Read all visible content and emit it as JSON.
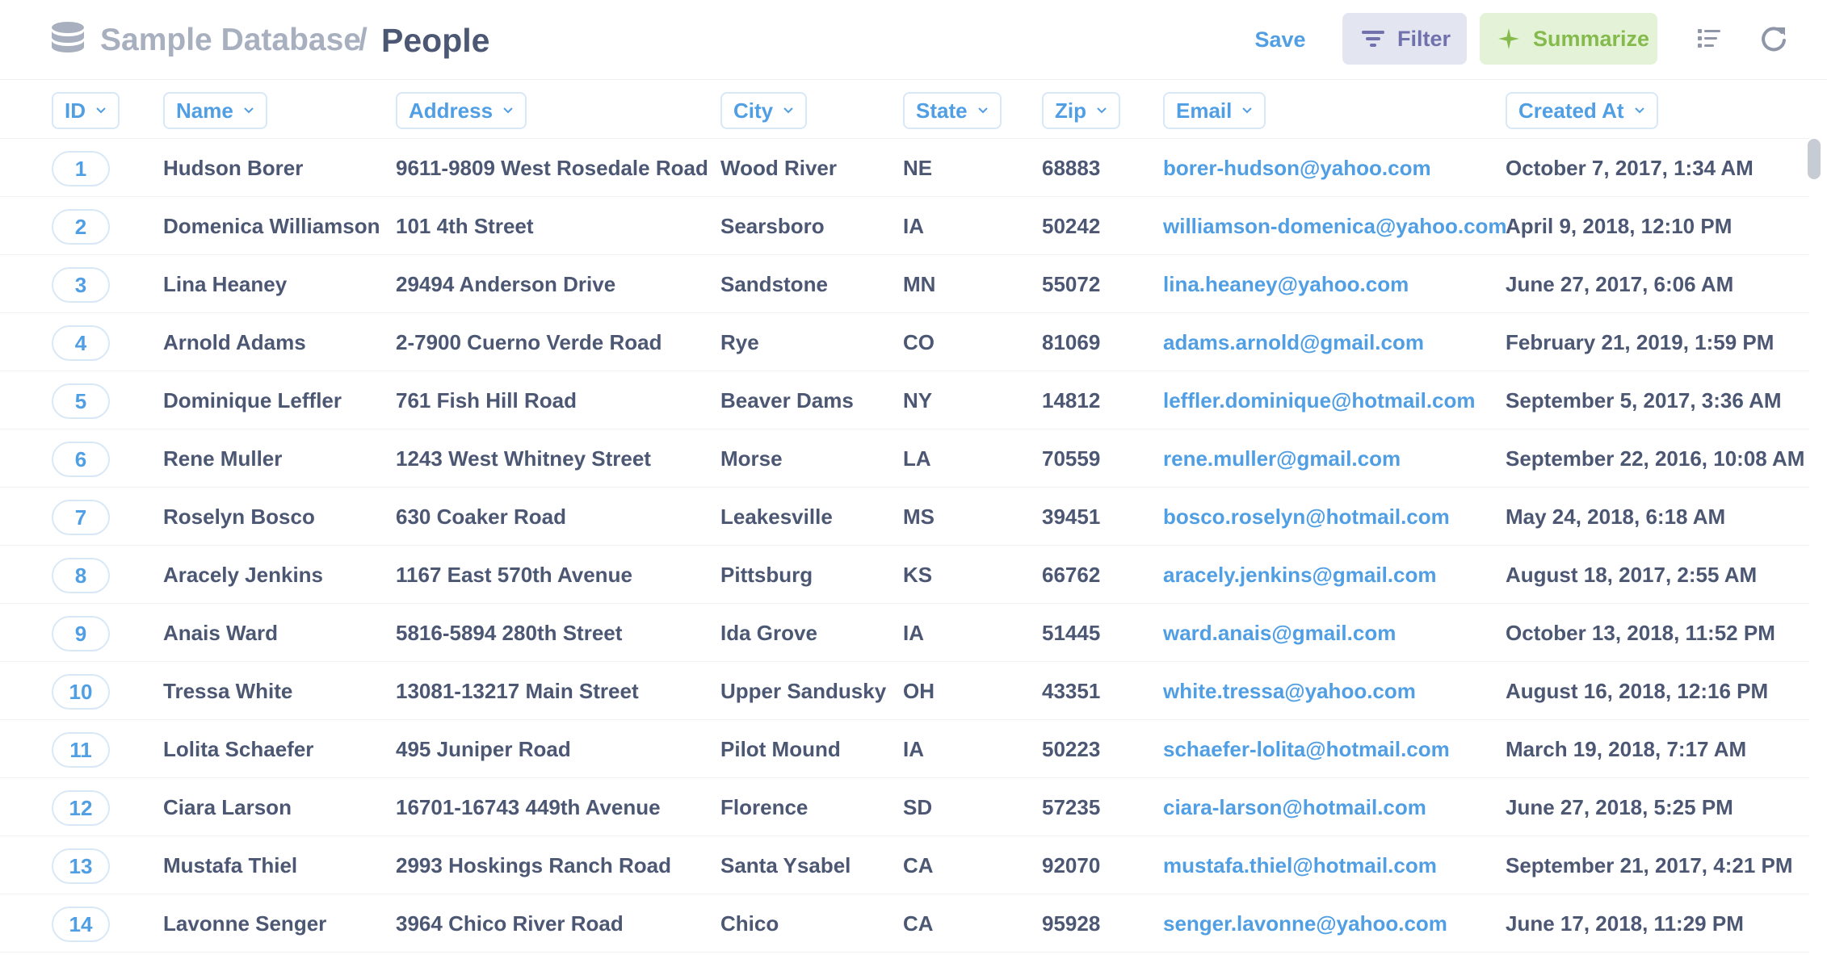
{
  "header": {
    "database": "Sample Database",
    "separator": "/",
    "table": "People",
    "save_label": "Save",
    "filter_label": "Filter",
    "summarize_label": "Summarize",
    "colors": {
      "accent": "#509ee3",
      "filter": "#7172ad",
      "summarize": "#84bb4c"
    }
  },
  "columns": [
    "ID",
    "Name",
    "Address",
    "City",
    "State",
    "Zip",
    "Email",
    "Created At"
  ],
  "rows": [
    [
      "1",
      "Hudson Borer",
      "9611-9809 West Rosedale Road",
      "Wood River",
      "NE",
      "68883",
      "borer-hudson@yahoo.com",
      "October 7, 2017, 1:34 AM"
    ],
    [
      "2",
      "Domenica Williamson",
      "101 4th Street",
      "Searsboro",
      "IA",
      "50242",
      "williamson-domenica@yahoo.com",
      "April 9, 2018, 12:10 PM"
    ],
    [
      "3",
      "Lina Heaney",
      "29494 Anderson Drive",
      "Sandstone",
      "MN",
      "55072",
      "lina.heaney@yahoo.com",
      "June 27, 2017, 6:06 AM"
    ],
    [
      "4",
      "Arnold Adams",
      "2-7900 Cuerno Verde Road",
      "Rye",
      "CO",
      "81069",
      "adams.arnold@gmail.com",
      "February 21, 2019, 1:59 PM"
    ],
    [
      "5",
      "Dominique Leffler",
      "761 Fish Hill Road",
      "Beaver Dams",
      "NY",
      "14812",
      "leffler.dominique@hotmail.com",
      "September 5, 2017, 3:36 AM"
    ],
    [
      "6",
      "Rene Muller",
      "1243 West Whitney Street",
      "Morse",
      "LA",
      "70559",
      "rene.muller@gmail.com",
      "September 22, 2016, 10:08 AM"
    ],
    [
      "7",
      "Roselyn Bosco",
      "630 Coaker Road",
      "Leakesville",
      "MS",
      "39451",
      "bosco.roselyn@hotmail.com",
      "May 24, 2018, 6:18 AM"
    ],
    [
      "8",
      "Aracely Jenkins",
      "1167 East 570th Avenue",
      "Pittsburg",
      "KS",
      "66762",
      "aracely.jenkins@gmail.com",
      "August 18, 2017, 2:55 AM"
    ],
    [
      "9",
      "Anais Ward",
      "5816-5894 280th Street",
      "Ida Grove",
      "IA",
      "51445",
      "ward.anais@gmail.com",
      "October 13, 2018, 11:52 PM"
    ],
    [
      "10",
      "Tressa White",
      "13081-13217 Main Street",
      "Upper Sandusky",
      "OH",
      "43351",
      "white.tressa@yahoo.com",
      "August 16, 2018, 12:16 PM"
    ],
    [
      "11",
      "Lolita Schaefer",
      "495 Juniper Road",
      "Pilot Mound",
      "IA",
      "50223",
      "schaefer-lolita@hotmail.com",
      "March 19, 2018, 7:17 AM"
    ],
    [
      "12",
      "Ciara Larson",
      "16701-16743 449th Avenue",
      "Florence",
      "SD",
      "57235",
      "ciara-larson@hotmail.com",
      "June 27, 2018, 5:25 PM"
    ],
    [
      "13",
      "Mustafa Thiel",
      "2993 Hoskings Ranch Road",
      "Santa Ysabel",
      "CA",
      "92070",
      "mustafa.thiel@hotmail.com",
      "September 21, 2017, 4:21 PM"
    ],
    [
      "14",
      "Lavonne Senger",
      "3964 Chico River Road",
      "Chico",
      "CA",
      "95928",
      "senger.lavonne@yahoo.com",
      "June 17, 2018, 11:29 PM"
    ]
  ]
}
